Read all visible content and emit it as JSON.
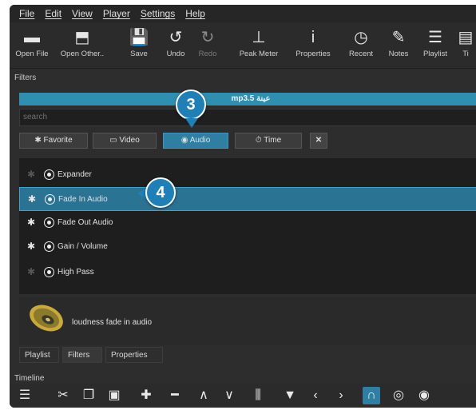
{
  "menu": [
    "File",
    "Edit",
    "View",
    "Player",
    "Settings",
    "Help"
  ],
  "toolbar": [
    {
      "label": "Open File",
      "icon": "folder-icon",
      "glyph": "▬"
    },
    {
      "label": "Open Other..",
      "icon": "open-other-icon",
      "glyph": "⬒"
    },
    {
      "label": "Save",
      "icon": "save-icon",
      "glyph": "💾"
    },
    {
      "label": "Undo",
      "icon": "undo-icon",
      "glyph": "↺"
    },
    {
      "label": "Redo",
      "icon": "redo-icon",
      "glyph": "↻"
    },
    {
      "label": "Peak Meter",
      "icon": "peak-meter-icon",
      "glyph": "⊥"
    },
    {
      "label": "Properties",
      "icon": "info-icon",
      "glyph": "i"
    },
    {
      "label": "Recent",
      "icon": "clock-icon",
      "glyph": "◷"
    },
    {
      "label": "Notes",
      "icon": "notes-icon",
      "glyph": "✎"
    },
    {
      "label": "Playlist",
      "icon": "list-icon",
      "glyph": "☰"
    },
    {
      "label": "Ti",
      "icon": "timeline-icon",
      "glyph": "▤"
    }
  ],
  "filters_title": "Filters",
  "clip_name": "mp3.5 عينة",
  "search_placeholder": "search",
  "filter_tabs": [
    {
      "label": "Favorite",
      "icon": "star-icon",
      "glyph": "✱"
    },
    {
      "label": "Video",
      "icon": "monitor-icon",
      "glyph": "▭"
    },
    {
      "label": "Audio",
      "icon": "audio-icon",
      "glyph": "◉"
    },
    {
      "label": "Time",
      "icon": "stopwatch-icon",
      "glyph": "⏱"
    },
    {
      "label": "",
      "icon": "close-icon",
      "glyph": "✕"
    }
  ],
  "filters": [
    {
      "name": "Expander",
      "favorite": false
    },
    {
      "name": "Fade In Audio",
      "favorite": true,
      "selected": true
    },
    {
      "name": "Fade Out Audio",
      "favorite": true
    },
    {
      "name": "Gain / Volume",
      "favorite": true
    },
    {
      "name": "High Pass",
      "favorite": false
    }
  ],
  "filter_description": "loudness fade in audio",
  "bottom_tabs": [
    "Playlist",
    "Filters",
    "Properties"
  ],
  "timeline_title": "Timeline",
  "timeline_tools": [
    {
      "icon": "menu-icon",
      "glyph": "☰"
    },
    {
      "icon": "cut-icon",
      "glyph": "✂"
    },
    {
      "icon": "copy-icon",
      "glyph": "❐"
    },
    {
      "icon": "paste-icon",
      "glyph": "▣"
    },
    {
      "icon": "add-icon",
      "glyph": "✚"
    },
    {
      "icon": "remove-icon",
      "glyph": "━"
    },
    {
      "icon": "lift-icon",
      "glyph": "∧"
    },
    {
      "icon": "overwrite-icon",
      "glyph": "∨"
    },
    {
      "icon": "split-icon",
      "glyph": "⫼"
    },
    {
      "icon": "marker-icon",
      "glyph": "▼"
    },
    {
      "icon": "prev-icon",
      "glyph": "‹"
    },
    {
      "icon": "next-icon",
      "glyph": "›"
    },
    {
      "icon": "snap-magnet-icon",
      "glyph": "∩"
    },
    {
      "icon": "ripple-icon",
      "glyph": "◎"
    },
    {
      "icon": "scrub-icon",
      "glyph": "◉"
    }
  ],
  "callouts": [
    "3",
    "4"
  ],
  "colors": {
    "accent": "#2f7fa2",
    "callout": "#1f80b8",
    "background": "#2d2d2d"
  }
}
